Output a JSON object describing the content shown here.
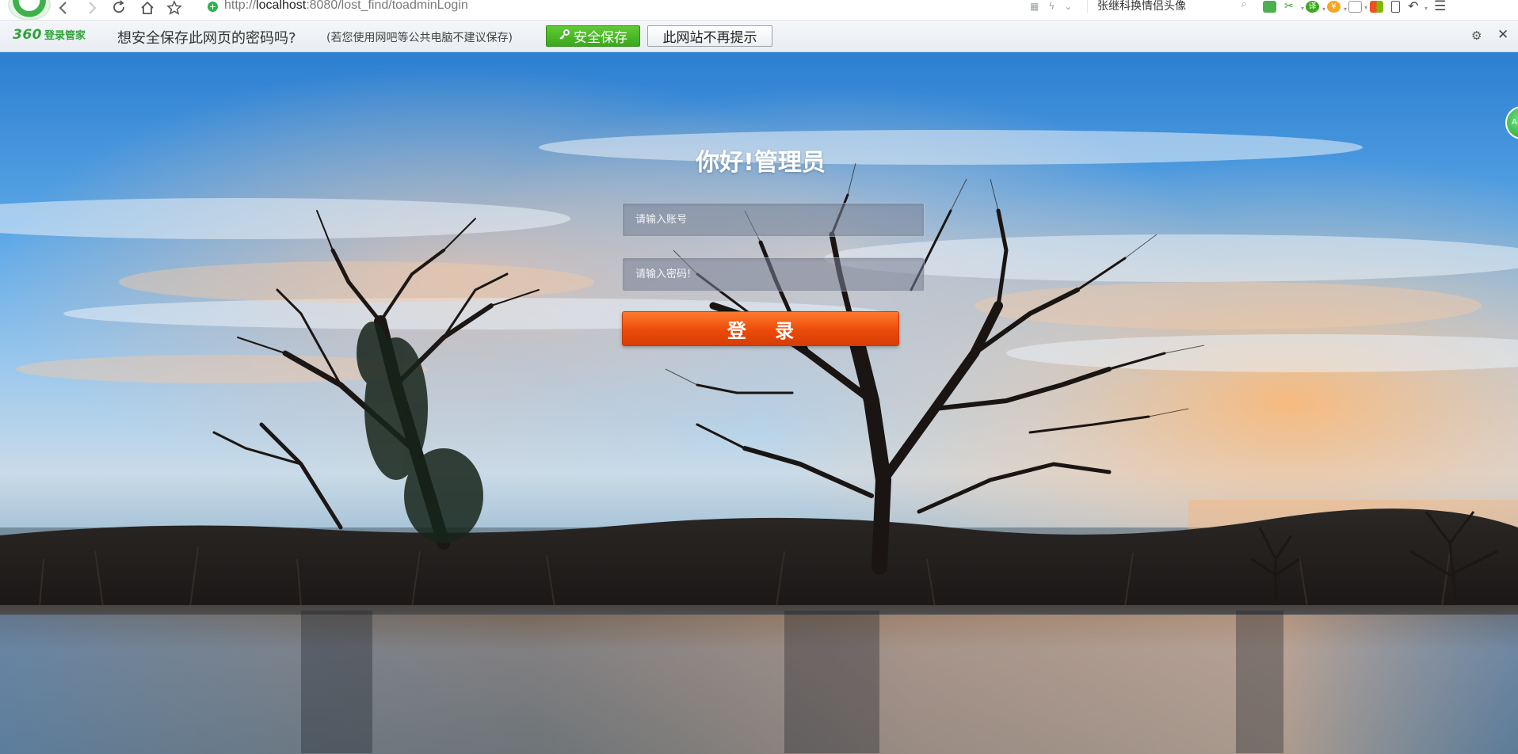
{
  "browser": {
    "url_prefix": "http://",
    "url_host": "localhost",
    "url_rest": ":8080/lost_find/toadminLogin",
    "search_query": "张继科换情侣头像"
  },
  "password_bar": {
    "brand_360": "360",
    "brand_label": "登录管家",
    "question": "想安全保存此网页的密码吗?",
    "note": "(若您使用网吧等公共电脑不建议保存)",
    "save_label": "安全保存",
    "never_label": "此网站不再提示"
  },
  "login": {
    "title": "你好!管理员",
    "account_placeholder": "请输入账号",
    "password_placeholder": "请输入密码!",
    "submit_label": "登 录"
  },
  "colors": {
    "accent_button": "#ec4a09",
    "brand_green": "#2fa33a",
    "save_green": "#3aa81c"
  }
}
